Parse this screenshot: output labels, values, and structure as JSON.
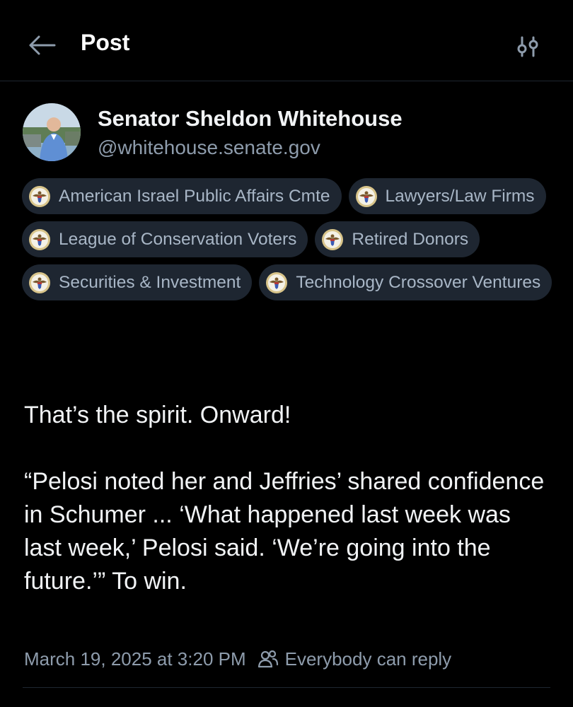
{
  "header": {
    "title": "Post",
    "back_icon": "arrow-left-icon",
    "filter_icon": "sliders-icon"
  },
  "author": {
    "display_name": "Senator Sheldon Whitehouse",
    "handle": "@whitehouse.senate.gov",
    "avatar_icon": "avatar-photo"
  },
  "labels": [
    "American Israel Public Affairs Cmte",
    "Lawyers/Law Firms",
    "League of Conservation Voters",
    "Retired Donors",
    "Securities & Investment",
    "Technology Crossover Ventures"
  ],
  "label_icon": "seal-icon",
  "post": {
    "line1": "That’s the spirit. Onward!",
    "quote": "“Pelosi noted her and Jeffries’ shared confidence in Schumer ... ‘What happened last week was last week,’ Pelosi said. ‘We’re going into the future.’” To win."
  },
  "meta": {
    "timestamp": "March 19, 2025 at 3:20 PM",
    "reply_setting": "Everybody can reply",
    "reply_icon": "people-icon"
  },
  "colors": {
    "background": "#000000",
    "text": "#f1f3f5",
    "muted": "#8e9cac",
    "pill_bg": "#1e2631",
    "pill_text": "#a8b6c6"
  }
}
